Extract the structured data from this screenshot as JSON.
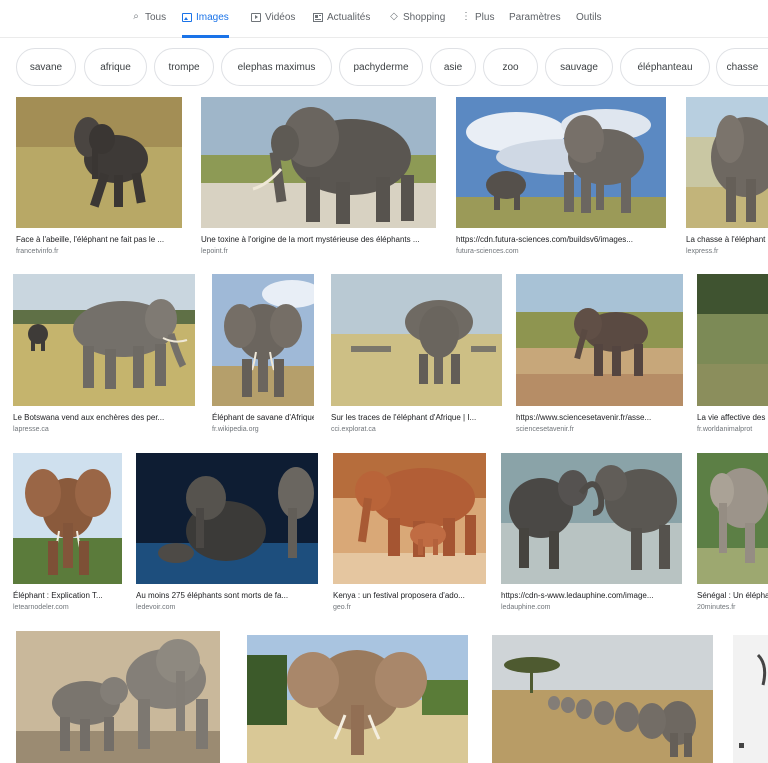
{
  "tabs": [
    {
      "label": "Tous",
      "icon": "search-icon"
    },
    {
      "label": "Images",
      "icon": "images-icon",
      "active": true
    },
    {
      "label": "Vidéos",
      "icon": "videos-icon"
    },
    {
      "label": "Actualités",
      "icon": "news-icon"
    },
    {
      "label": "Shopping",
      "icon": "shopping-tag-icon"
    },
    {
      "label": "Plus",
      "icon": "more-vert-icon"
    },
    {
      "label": "Paramètres"
    },
    {
      "label": "Outils"
    }
  ],
  "chips": [
    "savane",
    "afrique",
    "trompe",
    "elephas maximus",
    "pachyderme",
    "asie",
    "zoo",
    "sauvage",
    "éléphanteau",
    "chasse"
  ],
  "results": [
    {
      "caption": "Face à l'abeille, l'éléphant ne fait pas le ...",
      "source": "francetvinfo.fr"
    },
    {
      "caption": "Une toxine à l'origine de la mort mystérieuse des éléphants ...",
      "source": "lepoint.fr"
    },
    {
      "caption": "https://cdn.futura-sciences.com/buildsv6/images...",
      "source": "futura-sciences.com"
    },
    {
      "caption": "La chasse à l'éléphant",
      "source": "lexpress.fr"
    },
    {
      "caption": "Le Botswana vend aux enchères des per...",
      "source": "lapresse.ca"
    },
    {
      "caption": "Éléphant de savane d'Afrique",
      "source": "fr.wikipedia.org"
    },
    {
      "caption": "Sur les traces de l'éléphant d'Afrique | I...",
      "source": "cci.explorat.ca"
    },
    {
      "caption": "https://www.sciencesetavenir.fr/asse...",
      "source": "sciencesetavenir.fr"
    },
    {
      "caption": "La vie affective des",
      "source": "fr.worldanimalprot"
    },
    {
      "caption": "Éléphant : Explication T...",
      "source": "letearnodeler.com"
    },
    {
      "caption": "Au moins 275 éléphants sont morts de fa...",
      "source": "ledevoir.com"
    },
    {
      "caption": "Kenya : un festival proposera d'ado...",
      "source": "geo.fr"
    },
    {
      "caption": "https://cdn-s-www.ledauphine.com/image...",
      "source": "ledauphine.com"
    },
    {
      "caption": "Sénégal : Un éléphant",
      "source": "20minutes.fr"
    },
    {
      "caption": "",
      "source": ""
    },
    {
      "caption": "",
      "source": ""
    },
    {
      "caption": "",
      "source": ""
    },
    {
      "caption": "",
      "source": ""
    }
  ]
}
